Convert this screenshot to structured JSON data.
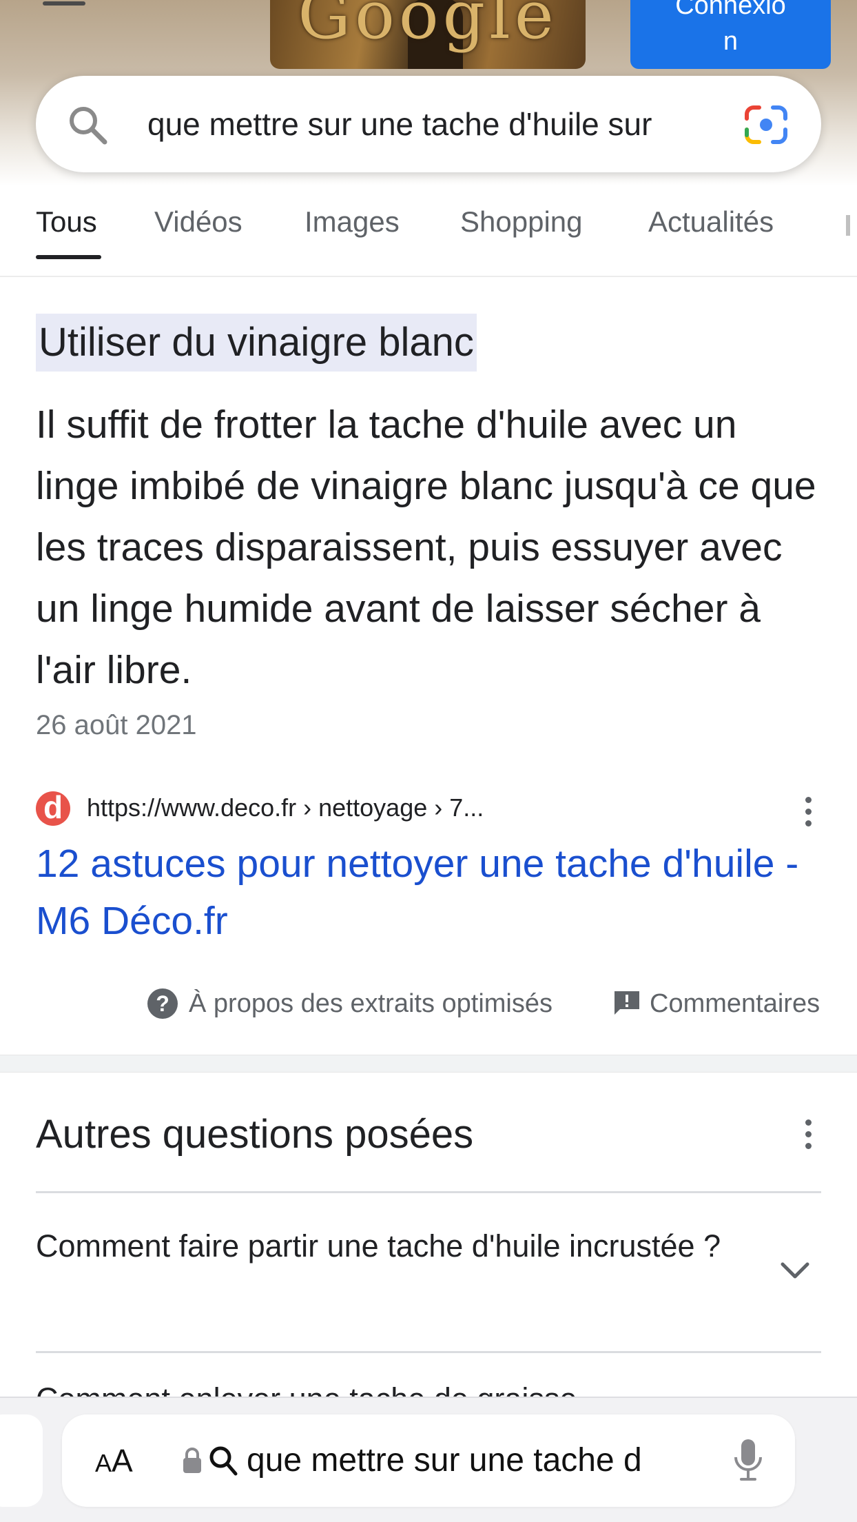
{
  "header": {
    "doodle_text": "Google",
    "login_button_line1": "Connexio",
    "login_button_line2": "n"
  },
  "search": {
    "query": "que mettre sur une tache d'huile sur"
  },
  "tabs": [
    {
      "label": "Tous"
    },
    {
      "label": "Vidéos"
    },
    {
      "label": "Images"
    },
    {
      "label": "Shopping"
    },
    {
      "label": "Actualités"
    }
  ],
  "snippet": {
    "title": "Utiliser du vinaigre blanc",
    "body": "Il suffit de frotter la tache d'huile avec un linge imbibé de vinaigre blanc jusqu'à ce que les traces disparaissent, puis essuyer avec un linge humide avant de laisser sécher à l'air libre.",
    "date": "26 août 2021",
    "favicon_letter": "d",
    "source_url": "https://www.deco.fr › nettoyage › 7...",
    "link_title": "12 astuces pour nettoyer une tache d'huile - M6 Déco.fr",
    "about_label": "À propos des extraits optimisés",
    "feedback_label": "Commentaires"
  },
  "paa": {
    "title": "Autres questions posées",
    "questions": [
      {
        "text": "Comment faire partir une tache d'huile incrustée ?"
      },
      {
        "text": "Comment enlever une tache de graisse"
      }
    ]
  },
  "browser_bar": {
    "aa_label_small": "A",
    "aa_label_large": "A",
    "address_text": "que mettre sur une tache d"
  },
  "colors": {
    "link_blue": "#1a4fcf",
    "button_blue": "#1a73e8",
    "highlight": "#e8eaf6"
  }
}
